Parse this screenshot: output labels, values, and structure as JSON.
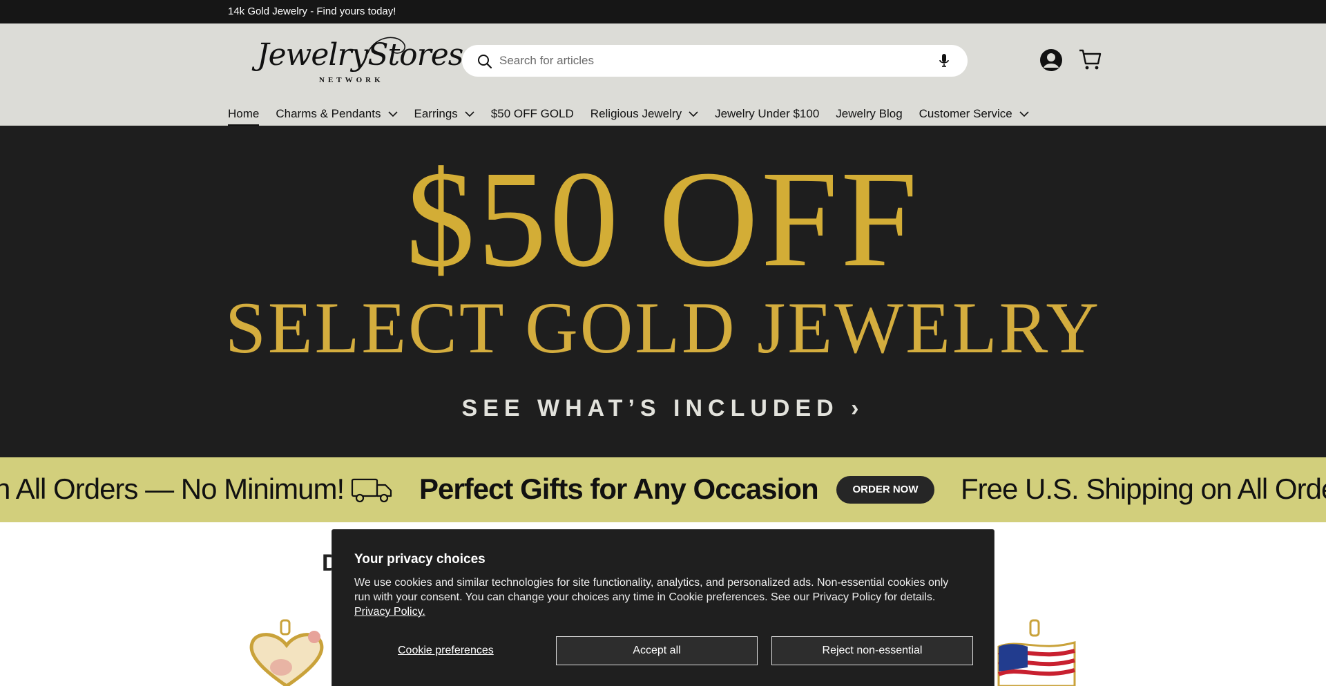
{
  "announcement": {
    "text": "14k Gold Jewelry - Find yours today!"
  },
  "header": {
    "logo": {
      "script": "JewelryStores",
      "sub": "NETWORK"
    },
    "search": {
      "placeholder": "Search for articles"
    },
    "icons": {
      "search": "search-icon",
      "mic": "microphone-icon",
      "account": "account-icon",
      "cart": "cart-icon"
    }
  },
  "nav": {
    "items": [
      {
        "label": "Home",
        "has_dropdown": false,
        "active": true
      },
      {
        "label": "Charms & Pendants",
        "has_dropdown": true
      },
      {
        "label": "Earrings",
        "has_dropdown": true
      },
      {
        "label": "$50 OFF GOLD",
        "has_dropdown": false
      },
      {
        "label": "Religious Jewelry",
        "has_dropdown": true
      },
      {
        "label": "Jewelry Under $100",
        "has_dropdown": false
      },
      {
        "label": "Jewelry Blog",
        "has_dropdown": false
      },
      {
        "label": "Customer Service",
        "has_dropdown": true
      }
    ]
  },
  "hero": {
    "headline": "$50 OFF",
    "subheadline": "SELECT GOLD JEWELRY",
    "cta": "SEE WHAT’S INCLUDED ›"
  },
  "marquee": {
    "left_text": "n All Orders — No Minimum!",
    "center_text": "Perfect Gifts for Any Occasion",
    "button": "ORDER NOW",
    "right_text": "Free U.S. Shipping on All Orders"
  },
  "section": {
    "title_start": "D",
    "title_end": "!"
  },
  "cookie": {
    "title": "Your privacy choices",
    "body": "We use cookies and similar technologies for site functionality, analytics, and personalized ads. Non-essential cookies only run with your consent. You can change your choices any time in Cookie preferences. See our Privacy Policy for details.",
    "policy_link": "Privacy Policy.",
    "preferences": "Cookie preferences",
    "accept": "Accept all",
    "reject": "Reject non-essential"
  },
  "colors": {
    "gold": "#d3ad36",
    "marquee_bg": "#d2cf7c",
    "dark": "#1e1e1e",
    "header_bg": "#dcdcd7"
  }
}
